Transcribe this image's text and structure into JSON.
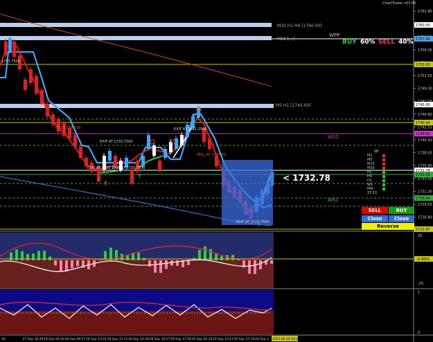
{
  "header": {
    "brand": "ChartTrader v02.00"
  },
  "price_axis": {
    "main_ticks": [
      "1762.80",
      "1760.55",
      "1758.30",
      "1756.05",
      "1753.80",
      "1751.55",
      "1749.30",
      "1747.05",
      "1744.80",
      "1742.55",
      "1740.30",
      "1738.05",
      "1735.80",
      "1733.55",
      "1731.30",
      "1729.05",
      "1726.80",
      "1724.55"
    ],
    "markers": [
      {
        "label": "1760.00",
        "color": "#ffffff"
      },
      {
        "label": "1757.04",
        "color": "#4fa3e0"
      },
      {
        "label": "1752.63",
        "color": "#c8c800"
      },
      {
        "label": "1745.00",
        "color": "#ffffff"
      },
      {
        "label": "1740.44",
        "color": "#c8c800"
      },
      {
        "label": "1738.00",
        "color": "#cc33cc"
      },
      {
        "label": "1732.78",
        "color": "#ffffff"
      },
      {
        "label": "1732.35",
        "color": "#33aa33"
      },
      {
        "label": "1728.54",
        "color": "#33aa33"
      },
      {
        "label": "1722.87",
        "color": "#c8c800"
      }
    ],
    "osc1_ticks": [
      "25",
      "-25"
    ],
    "osc1_marker": {
      "label": "-0.4601",
      "color": "#c8c800"
    },
    "osc2_ticks": [
      "1",
      "0"
    ]
  },
  "levels": {
    "m30_label": "M30 H1 H4  [1760.00]",
    "m15_label": "M15 [...]",
    "m5_label": "M5 H1  [1745.00]",
    "wpp": "WPP",
    "ws1": "WS1",
    "ws2": "WS2"
  },
  "signal": {
    "buy_label": "BUY",
    "buy_pct": "60%",
    "sell_label": "SELL",
    "sell_pct": "40%"
  },
  "current_price": "< 1732.78",
  "exit_labels": [
    "EXIT AT 1733.7500",
    "EXIT AT 1733.7500",
    "EXIT AT 1733.7500",
    "EXIT AT 1741.2500",
    "EXIT AT 1723.7500",
    "1753.7500"
  ],
  "annotations": {
    "sell_note": "SELL AT 1738.00",
    "hold_note": "HOLD 1740.00"
  },
  "timeframes": {
    "labels": [
      "M1",
      "M5",
      "M15",
      "M30",
      "H1",
      "H4",
      "D1",
      "W1",
      "MN"
    ],
    "top_value": "18",
    "timer": "27:11"
  },
  "panel": {
    "sell": "SELL",
    "buy": "BUY",
    "close_sell": "Close Sell",
    "close_buy": "Close Buy",
    "reverse": "Reverse"
  },
  "time_axis": {
    "labels": [
      "26",
      "27 Sep 16:49",
      "28 Sep 04:02",
      "28 Sep 09:27",
      "28 Sep 13:01",
      "28 Sep 15:21",
      "28 Sep 16:28",
      "28 Sep 16:57",
      "28 Sep 17:56",
      "29 Sep 05:35",
      "29 Sep 13:12",
      "29 Sep 17:19",
      "29 Sep 2"
    ],
    "highlight": "2021.09.30 02:04"
  }
}
